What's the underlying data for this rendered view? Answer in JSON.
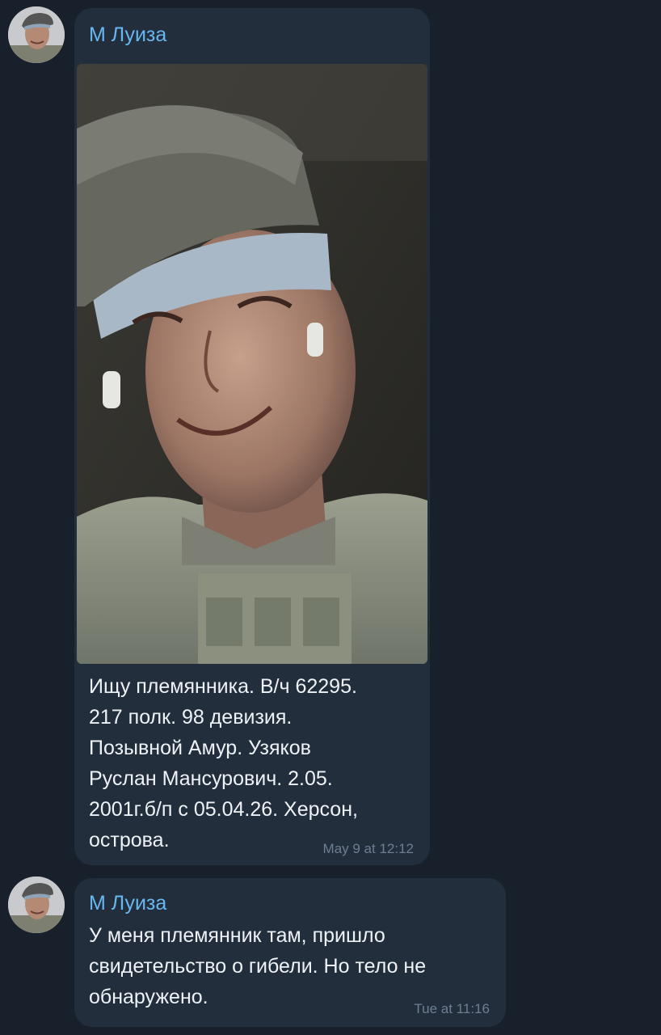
{
  "messages": [
    {
      "sender": "М Луиза",
      "has_photo": true,
      "photo_description": "selfie-photo",
      "text": "Ищу племянника. В/ч 62295.\n217 полк. 98 девизия.\nПозывной Амур. Узяков\nРуслан Мансурович. 2.05.\n2001г.б/п с 05.04.26. Херсон,\nострова.",
      "time": "May 9 at 12:12"
    },
    {
      "sender": "М Луиза",
      "has_photo": false,
      "text": "У меня племянник там, пришло\nсвидетельство о гибели.  Но тело не\nобнаружено.",
      "time": "Tue at 11:16"
    }
  ],
  "colors": {
    "background": "#18202b",
    "bubble": "#222e3c",
    "sender_name": "#67b8f0",
    "text": "#eef2f6",
    "timestamp": "#6d7f92"
  }
}
